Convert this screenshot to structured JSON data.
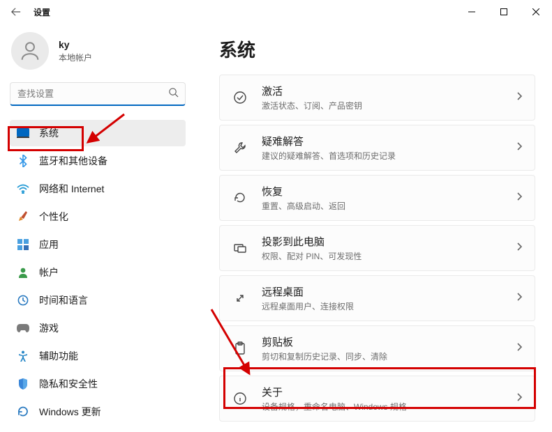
{
  "app": {
    "title": "设置"
  },
  "user": {
    "name": "ky",
    "sub": "本地帐户"
  },
  "search": {
    "placeholder": "查找设置"
  },
  "nav": [
    {
      "label": "系统",
      "icon": "system"
    },
    {
      "label": "蓝牙和其他设备",
      "icon": "bluetooth"
    },
    {
      "label": "网络和 Internet",
      "icon": "wifi"
    },
    {
      "label": "个性化",
      "icon": "brush"
    },
    {
      "label": "应用",
      "icon": "apps"
    },
    {
      "label": "帐户",
      "icon": "person"
    },
    {
      "label": "时间和语言",
      "icon": "time"
    },
    {
      "label": "游戏",
      "icon": "game"
    },
    {
      "label": "辅助功能",
      "icon": "accessibility"
    },
    {
      "label": "隐私和安全性",
      "icon": "shield"
    },
    {
      "label": "Windows 更新",
      "icon": "update"
    }
  ],
  "page": {
    "title": "系统"
  },
  "cards": [
    {
      "title": "激活",
      "sub": "激活状态、订阅、产品密钥",
      "icon": "check"
    },
    {
      "title": "疑难解答",
      "sub": "建议的疑难解答、首选项和历史记录",
      "icon": "wrench"
    },
    {
      "title": "恢复",
      "sub": "重置、高级启动、返回",
      "icon": "recovery"
    },
    {
      "title": "投影到此电脑",
      "sub": "权限、配对 PIN、可发现性",
      "icon": "project"
    },
    {
      "title": "远程桌面",
      "sub": "远程桌面用户、连接权限",
      "icon": "remote"
    },
    {
      "title": "剪贴板",
      "sub": "剪切和复制历史记录、同步、清除",
      "icon": "clipboard"
    },
    {
      "title": "关于",
      "sub": "设备规格，重命名电脑、Windows 规格",
      "icon": "info"
    }
  ]
}
